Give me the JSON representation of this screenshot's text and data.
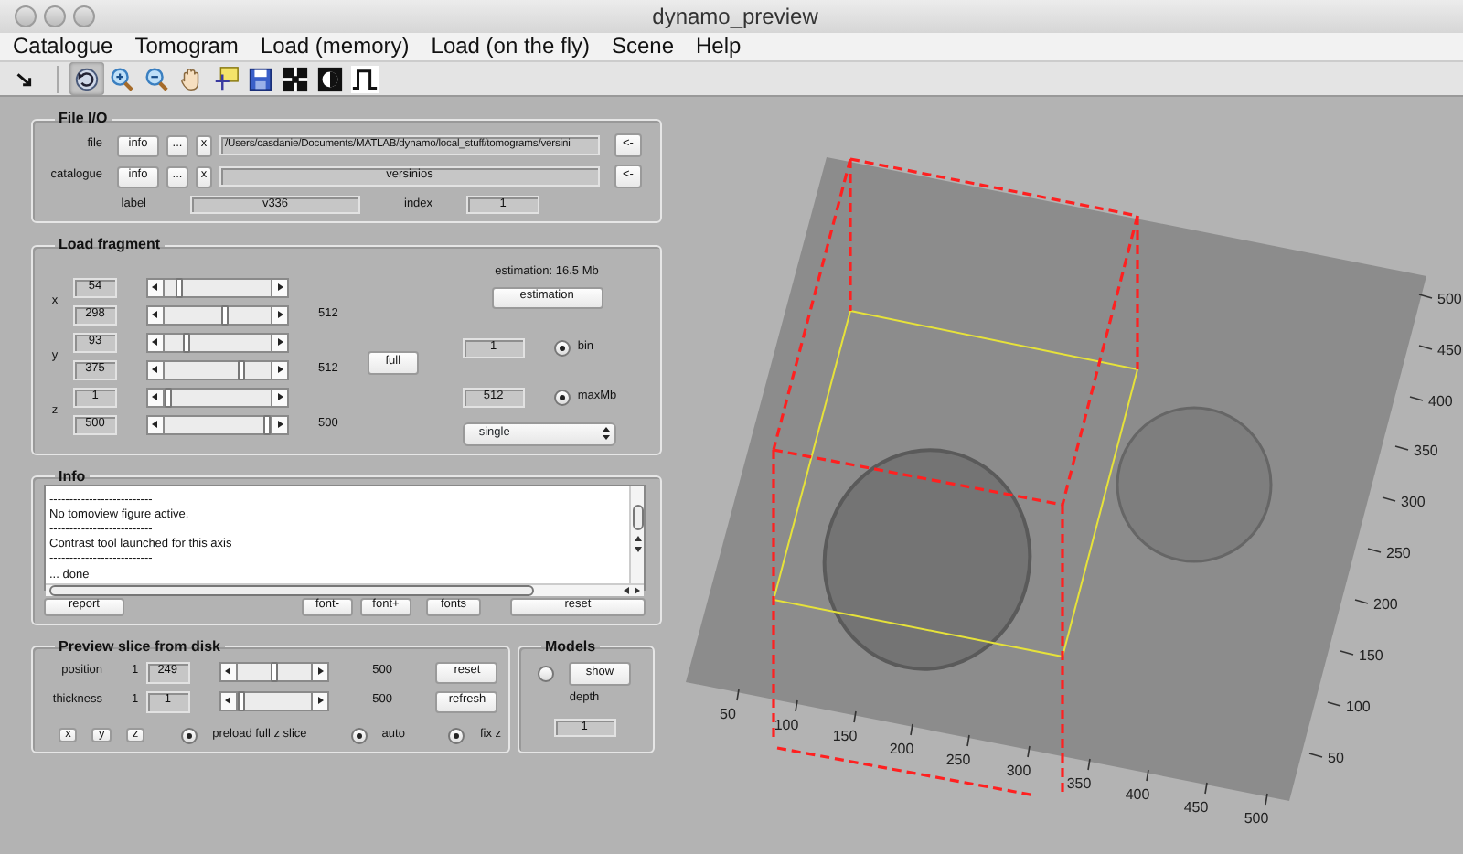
{
  "window": {
    "title": "dynamo_preview"
  },
  "menu": [
    "Catalogue",
    "Tomogram",
    "Load (memory)",
    "Load (on the fly)",
    "Scene",
    "Help"
  ],
  "toolbar": [
    {
      "kind": "arrow",
      "selected": false
    },
    {
      "kind": "rotate",
      "selected": true
    },
    {
      "kind": "zoom-in",
      "selected": false
    },
    {
      "kind": "zoom-out",
      "selected": false
    },
    {
      "kind": "hand",
      "selected": false
    },
    {
      "kind": "data-tip",
      "selected": false
    },
    {
      "kind": "save",
      "selected": false
    },
    {
      "kind": "grid",
      "selected": false
    },
    {
      "kind": "contrast",
      "selected": false
    },
    {
      "kind": "square-wave",
      "selected": false
    }
  ],
  "file_io": {
    "title": "File I/O",
    "rows": [
      {
        "label": "file",
        "info": "info",
        "browse": "...",
        "clear": "x",
        "value": "/Users/casdanie/Documents/MATLAB/dynamo/local_stuff/tomograms/versini",
        "back": "<-"
      },
      {
        "label": "catalogue",
        "info": "info",
        "browse": "...",
        "clear": "x",
        "value": "versinios",
        "back": "<-"
      }
    ],
    "label": {
      "label": "label",
      "value": "v336"
    },
    "index": {
      "label": "index",
      "value": "1"
    }
  },
  "load_fragment": {
    "title": "Load fragment",
    "axes": [
      {
        "axis": "x",
        "min": {
          "value": "54",
          "level": 0.105
        },
        "max": {
          "value": "298",
          "level": 0.582
        },
        "size": "512"
      },
      {
        "axis": "y",
        "min": {
          "value": "93",
          "level": 0.182
        },
        "max": {
          "value": "375",
          "level": 0.732
        },
        "size": "512"
      },
      {
        "axis": "z",
        "min": {
          "value": "1",
          "level": 0.0
        },
        "max": {
          "value": "500",
          "level": 1.0
        },
        "size": "500"
      }
    ],
    "full": "full",
    "estimation_text": "estimation: 16.5 Mb",
    "estimation_button": "estimation",
    "bin": {
      "value": "1",
      "label": "bin",
      "checked": true
    },
    "maxmb": {
      "value": "512",
      "label": "maxMb",
      "checked": true
    },
    "mode": "single"
  },
  "info": {
    "title": "Info",
    "lines": [
      "--------------------------",
      "No tomoview figure active.",
      "--------------------------",
      "Contrast tool launched for this axis",
      "--------------------------",
      "... done"
    ],
    "buttons": [
      "report",
      "font-",
      "font+",
      "fonts",
      "reset"
    ]
  },
  "preview": {
    "title": "Preview slice from disk",
    "rows": [
      {
        "label": "position",
        "min": "1",
        "value": "249",
        "level": 0.498,
        "max": "500",
        "button": "reset"
      },
      {
        "label": "thickness",
        "min": "1",
        "value": "1",
        "level": 0.0,
        "max": "500",
        "button": "refresh"
      }
    ],
    "axis_buttons": [
      "x",
      "y",
      "z"
    ],
    "options": [
      {
        "label": "preload full z slice",
        "checked": true
      },
      {
        "label": "auto",
        "checked": true
      },
      {
        "label": "fix z",
        "checked": true
      }
    ]
  },
  "models": {
    "title": "Models",
    "checked": false,
    "show": "show",
    "depth_label": "depth",
    "depth": "1"
  },
  "view": {
    "x_ticks": [
      "50",
      "100",
      "150",
      "200",
      "250",
      "300",
      "350",
      "400",
      "450",
      "500"
    ],
    "y_ticks": [
      "50",
      "100",
      "150",
      "200",
      "250",
      "300",
      "350",
      "400",
      "450",
      "500"
    ]
  }
}
